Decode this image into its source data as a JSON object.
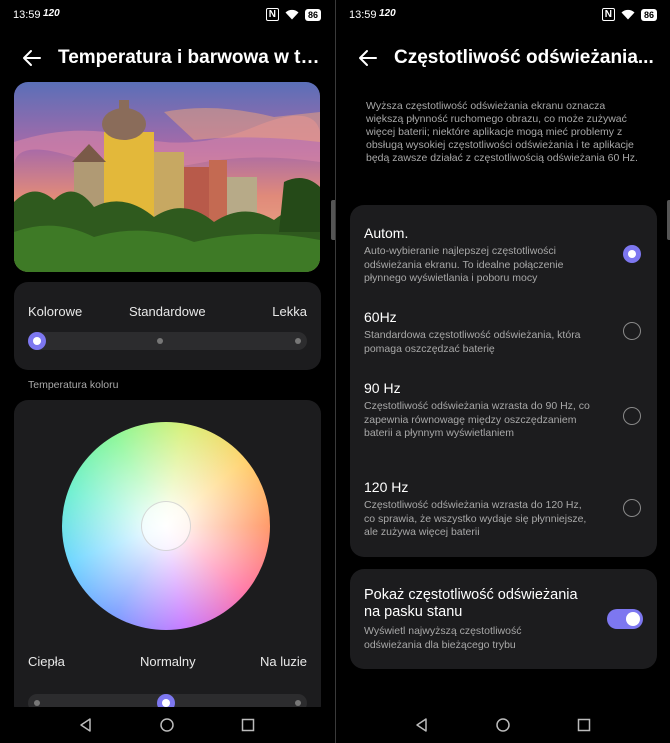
{
  "status_left": {
    "time": "13:59",
    "hz": "120",
    "battery": "86"
  },
  "status_right": {
    "time": "13:59",
    "hz": "120",
    "battery": "86"
  },
  "left": {
    "title": "Temperatura i barwowa w tr...",
    "mode": {
      "labels": [
        "Kolorowe",
        "Standardowe",
        "Lekka"
      ],
      "selected": "Kolorowe"
    },
    "temp_section_label": "Temperatura koloru",
    "temp": {
      "labels": [
        "Ciepła",
        "Normalny",
        "Na luzie"
      ],
      "selected": "Normalny"
    }
  },
  "right": {
    "title": "Częstotliwość odświeżania...",
    "description": "Wyższa częstotliwość odświeżania ekranu oznacza większą płynność ruchomego obrazu, co może zużywać więcej baterii; niektóre aplikacje mogą mieć problemy z obsługą wysokiej częstotliwości odświeżania i te aplikacje będą zawsze działać z częstotliwością odświeżania 60 Hz.",
    "options": [
      {
        "title": "Autom.",
        "subtitle": "Auto-wybieranie najlepszej częstotliwości odświeżania ekranu. To idealne połączenie płynnego wyświetlania i poboru mocy",
        "selected": true
      },
      {
        "title": "60Hz",
        "subtitle": "Standardowa częstotliwość odświeżania, która pomaga oszczędzać baterię",
        "selected": false
      },
      {
        "title": "90 Hz",
        "subtitle": "Częstotliwość odświeżania wzrasta do 90 Hz, co zapewnia równowagę między oszczędzaniem baterii a płynnym wyświetlaniem",
        "selected": false
      },
      {
        "title": "120 Hz",
        "subtitle": "Częstotliwość odświeżania wzrasta do 120 Hz, co sprawia, że wszystko wydaje się płynniejsze, ale zużywa więcej baterii",
        "selected": false
      }
    ],
    "show_toggle": {
      "title": "Pokaż częstotliwość odświeżania na pasku stanu",
      "subtitle": "Wyświetl najwyższą częstotliwość odświeżania dla bieżącego trybu",
      "on": true
    }
  },
  "colors": {
    "accent": "#7d77f0",
    "card": "#1c1c1e",
    "background": "#000000"
  }
}
